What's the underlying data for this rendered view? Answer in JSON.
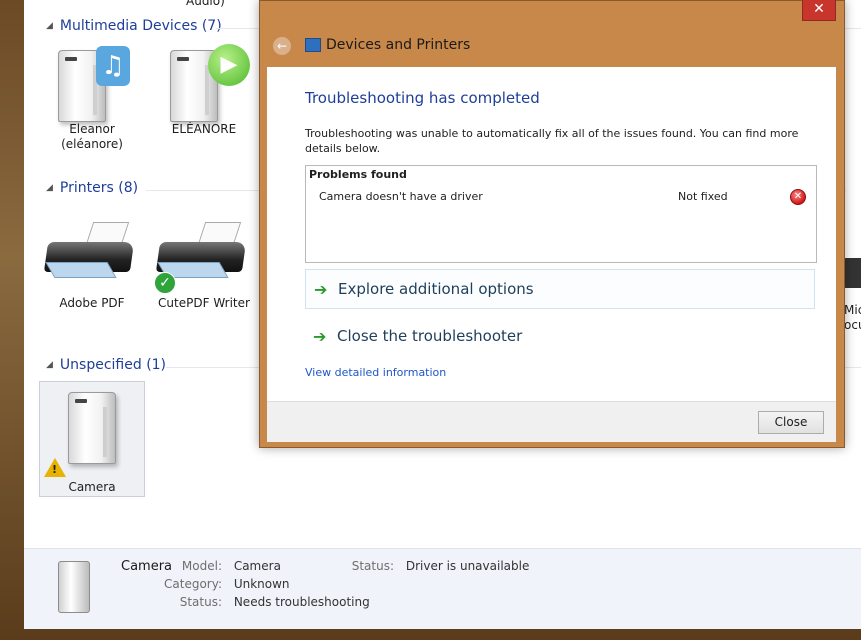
{
  "background_window": {
    "groups": [
      {
        "title": "Multimedia Devices (7)"
      },
      {
        "title": "Printers (8)"
      },
      {
        "title": "Unspecified (1)"
      }
    ],
    "top_clip_text": "Audio)",
    "multimedia_devices": [
      {
        "label": "Eleanor\n(eléanore)"
      },
      {
        "label": "ELÉANORE"
      }
    ],
    "printers": [
      {
        "label": "Adobe PDF"
      },
      {
        "label": "CutePDF Writer"
      }
    ],
    "unspecified": [
      {
        "label": "Camera"
      }
    ],
    "right_clip_text_1": "Mic",
    "right_clip_text_2": "ocu"
  },
  "status_bar": {
    "device_name": "Camera",
    "model_label": "Model:",
    "model_value": "Camera",
    "category_label": "Category:",
    "category_value": "Unknown",
    "status_label": "Status:",
    "status_value": "Needs troubleshooting",
    "status2_label": "Status:",
    "status2_value": "Driver is unavailable"
  },
  "dialog": {
    "title": "Devices and Printers",
    "heading": "Troubleshooting has completed",
    "description": "Troubleshooting was unable to automatically fix all of the issues found. You can find more details below.",
    "problems_header": "Problems found",
    "problems": [
      {
        "name": "Camera doesn't have a driver",
        "status": "Not fixed"
      }
    ],
    "option_explore": "Explore additional options",
    "option_close": "Close the troubleshooter",
    "detail_link": "View detailed information",
    "close_button": "Close",
    "close_x": "✕"
  }
}
